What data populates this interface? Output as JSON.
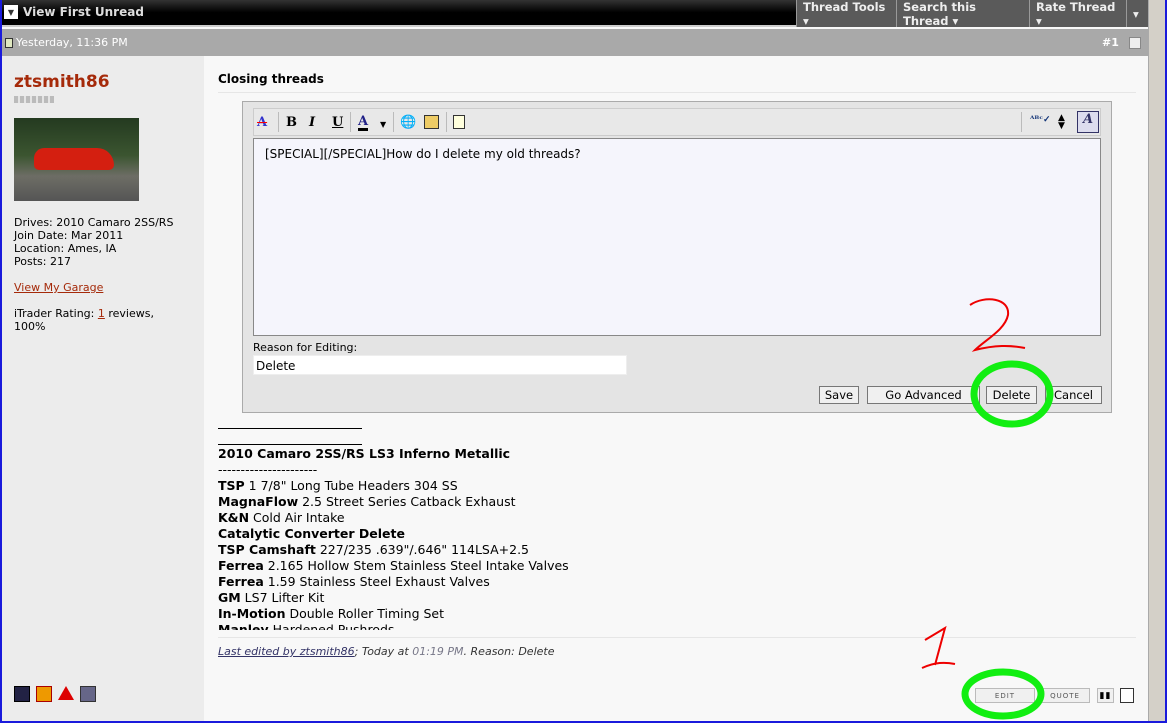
{
  "topbar": {
    "view_first_unread": "View First Unread",
    "thread_tools": "Thread Tools ▾",
    "search_thread": "Search this Thread ▾",
    "rate_thread": "Rate Thread ▾",
    "more": "▾"
  },
  "post": {
    "date": "Yesterday, 11:36 PM",
    "number": "#1",
    "title": "Closing threads"
  },
  "user": {
    "name": "ztsmith86",
    "drives": "Drives: 2010 Camaro 2SS/RS",
    "join": "Join Date: Mar 2011",
    "location": "Location: Ames, IA",
    "posts": "Posts: 217",
    "garage": "View My Garage",
    "itrader_prefix": "iTrader Rating: ",
    "itrader_count": "1",
    "itrader_suffix": " reviews, 100%"
  },
  "editor": {
    "content": "[SPECIAL][/SPECIAL]How do I delete my old threads?",
    "reason_label": "Reason for Editing:",
    "reason_value": "Delete",
    "save": "Save",
    "go_advanced": "Go Advanced",
    "delete": "Delete",
    "cancel": "Cancel"
  },
  "signature": {
    "heading": "2010 Camaro 2SS/RS LS3 Inferno Metallic",
    "dashes": "----------------------",
    "items": [
      {
        "b": "TSP",
        "t": " 1 7/8\" Long Tube Headers 304 SS"
      },
      {
        "b": "MagnaFlow",
        "t": " 2.5 Street Series Catback Exhaust"
      },
      {
        "b": "K&N",
        "t": " Cold Air Intake"
      },
      {
        "b": "Catalytic Converter Delete",
        "t": ""
      },
      {
        "b": "TSP Camshaft",
        "t": " 227/235 .639\"/.646\" 114LSA+2.5"
      },
      {
        "b": "Ferrea",
        "t": " 2.165 Hollow Stem Stainless Steel Intake Valves"
      },
      {
        "b": "Ferrea",
        "t": " 1.59 Stainless Steel Exhaust Valves"
      },
      {
        "b": "GM",
        "t": " LS7 Lifter Kit"
      },
      {
        "b": "In-Motion",
        "t": " Double Roller Timing Set"
      },
      {
        "b": "Manley",
        "t": " Hardened Pushrods"
      }
    ]
  },
  "edited": {
    "by": "Last edited by ztsmith86",
    "today": "; Today at ",
    "time": "01:19 PM",
    "reason": ". Reason: Delete"
  },
  "post_buttons": {
    "edit": "EDIT",
    "quote": "QUOTE"
  },
  "annotations": {
    "one": "1",
    "two": "2"
  }
}
